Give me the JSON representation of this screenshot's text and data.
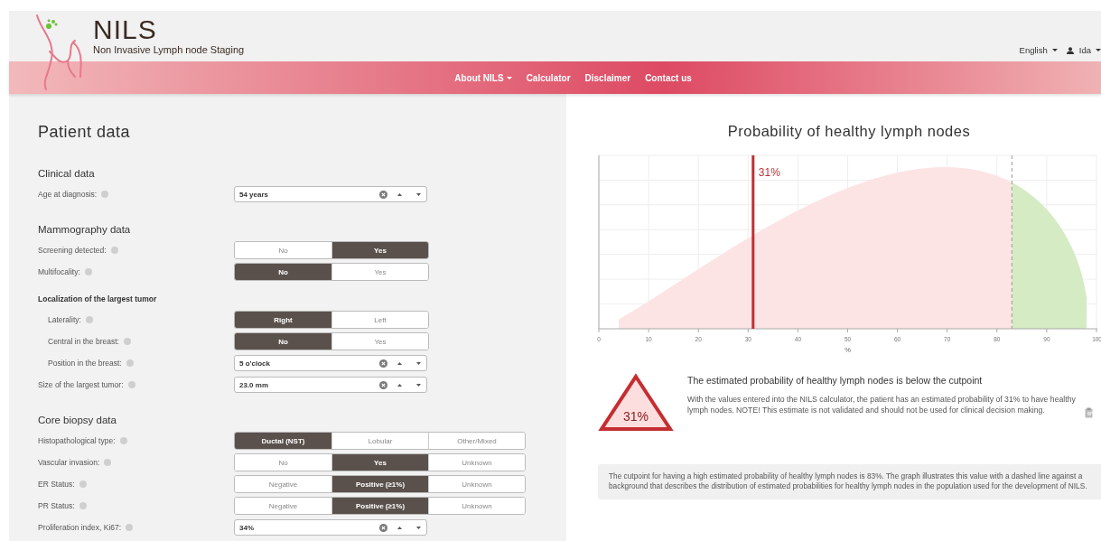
{
  "header": {
    "title": "NILS",
    "subtitle": "Non Invasive Lymph node Staging",
    "language": "English",
    "user": "Ida"
  },
  "nav": [
    {
      "label": "About NILS",
      "dropdown": true
    },
    {
      "label": "Calculator",
      "dropdown": false
    },
    {
      "label": "Disclaimer",
      "dropdown": false
    },
    {
      "label": "Contact us",
      "dropdown": false
    }
  ],
  "patient": {
    "title": "Patient data",
    "sections": [
      {
        "title": "Clinical data",
        "rows": [
          {
            "kind": "spinner",
            "label": "Age at diagnosis:",
            "value": "54 years"
          }
        ]
      },
      {
        "title": "Mammography data",
        "rows": [
          {
            "kind": "toggle",
            "label": "Screening detected:",
            "options": [
              {
                "label": "No",
                "selected": false
              },
              {
                "label": "Yes",
                "selected": true
              }
            ]
          },
          {
            "kind": "toggle",
            "label": "Multifocality:",
            "options": [
              {
                "label": "No",
                "selected": true
              },
              {
                "label": "Yes",
                "selected": false
              }
            ]
          },
          {
            "kind": "group",
            "label": "Localization of the largest tumor",
            "children": [
              {
                "kind": "toggle",
                "label": "Laterality:",
                "options": [
                  {
                    "label": "Right",
                    "selected": true
                  },
                  {
                    "label": "Left",
                    "selected": false
                  }
                ]
              },
              {
                "kind": "toggle",
                "label": "Central in the breast:",
                "options": [
                  {
                    "label": "No",
                    "selected": true
                  },
                  {
                    "label": "Yes",
                    "selected": false
                  }
                ]
              },
              {
                "kind": "spinner",
                "label": "Position in the breast:",
                "value": "5 o'clock"
              }
            ]
          },
          {
            "kind": "spinner",
            "label": "Size of the largest tumor:",
            "value": "23.0 mm"
          }
        ]
      },
      {
        "title": "Core biopsy data",
        "rows": [
          {
            "kind": "toggle",
            "label": "Histopathological type:",
            "options": [
              {
                "label": "Ductal (NST)",
                "selected": true
              },
              {
                "label": "Lobular",
                "selected": false
              },
              {
                "label": "Other/Mixed",
                "selected": false
              }
            ]
          },
          {
            "kind": "toggle",
            "label": "Vascular invasion:",
            "options": [
              {
                "label": "No",
                "selected": false
              },
              {
                "label": "Yes",
                "selected": true
              },
              {
                "label": "Unknown",
                "selected": false
              }
            ]
          },
          {
            "kind": "toggle",
            "label": "ER Status:",
            "options": [
              {
                "label": "Negative",
                "selected": false
              },
              {
                "label": "Positive (≥1%)",
                "selected": true
              },
              {
                "label": "Unknown",
                "selected": false
              }
            ]
          },
          {
            "kind": "toggle",
            "label": "PR Status:",
            "options": [
              {
                "label": "Negative",
                "selected": false
              },
              {
                "label": "Positive (≥1%)",
                "selected": true
              },
              {
                "label": "Unknown",
                "selected": false
              }
            ]
          },
          {
            "kind": "spinner",
            "label": "Proliferation index, Ki67:",
            "value": "34%"
          }
        ]
      }
    ]
  },
  "result": {
    "title": "Probability of healthy lymph nodes",
    "chart": {
      "marker_label": "31%",
      "xlabel": "%",
      "xticks": [
        "0",
        "10",
        "20",
        "30",
        "40",
        "50",
        "60",
        "70",
        "80",
        "90",
        "100"
      ]
    },
    "badge": "31%",
    "heading": "The estimated probability of healthy lymph nodes is below the cutpoint",
    "text": "With the values entered into the NILS calculator, the patient has an estimated probability of 31% to have healthy lymph nodes. NOTE! This estimate is not validated and should not be used for clinical decision making.",
    "note": "The cutpoint for having a high estimated probability of healthy lymph nodes is 83%. The graph illustrates this value with a dashed line against a background that describes the distribution of estimated probabilities for healthy lymph nodes in the population used for the development of NILS."
  }
}
